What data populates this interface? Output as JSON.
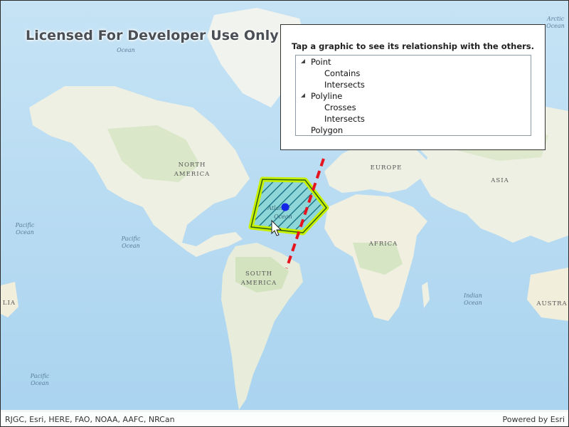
{
  "watermark": "Licensed For Developer Use Only",
  "panel": {
    "title": "Tap a graphic to see its relationship with the others.",
    "tree": {
      "point_label": "Point",
      "point_children": [
        "Contains",
        "Intersects"
      ],
      "polyline_label": "Polyline",
      "polyline_children": [
        "Crosses",
        "Intersects"
      ],
      "polygon_label": "Polygon"
    }
  },
  "map_labels": {
    "north_america": [
      "NORTH",
      "AMERICA"
    ],
    "south_america": [
      "SOUTH",
      "AMERICA"
    ],
    "europe": "EUROPE",
    "asia": "ASIA",
    "africa": "AFRICA",
    "australia_partial": "AUSTRA",
    "australia_left_partial": "LIA",
    "pacific_ocean": [
      "Pacific",
      "Ocean"
    ],
    "atlantic_ocean": [
      "Atlantic",
      "Ocean"
    ],
    "indian_ocean": [
      "Indian",
      "Ocean"
    ],
    "arctic_ocean": [
      "Arctic",
      "Ocean"
    ],
    "ocean_top_left": "Ocean"
  },
  "attribution": {
    "left": "RJGC, Esri, HERE, FAO, NOAA, AAFC, NRCan",
    "right": "Powered by Esri"
  },
  "colors": {
    "water": "#b9dcf3",
    "land": "#eef0e3",
    "polygon_outline": "#c6f000",
    "polygon_hatch": "#1f7a8c",
    "polyline": "#e5141e",
    "point": "#1326e8"
  }
}
